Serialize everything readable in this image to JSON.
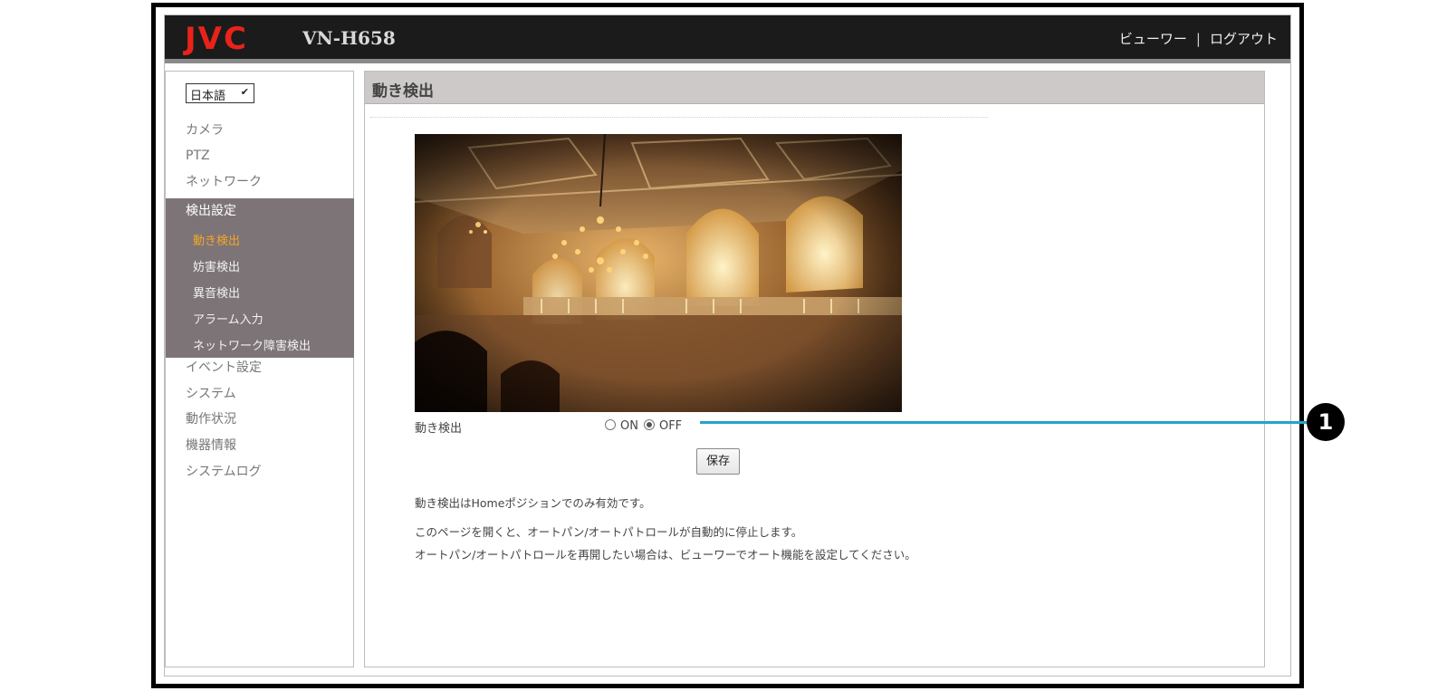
{
  "header": {
    "logo": "JVC",
    "model": "VN-H658",
    "links": {
      "viewer": "ビューワー",
      "separator": "|",
      "logout": "ログアウト"
    }
  },
  "sidebar": {
    "language": "日本語",
    "items_top": [
      "カメラ",
      "PTZ",
      "ネットワーク"
    ],
    "group": {
      "title": "検出設定",
      "items": [
        "動き検出",
        "妨害検出",
        "異音検出",
        "アラーム入力",
        "ネットワーク障害検出"
      ],
      "active_index": 0
    },
    "items_bottom": [
      "イベント設定",
      "システム",
      "動作状況",
      "機器情報",
      "システムログ"
    ]
  },
  "main": {
    "title": "動き検出",
    "setting": {
      "label": "動き検出",
      "options": [
        "ON",
        "OFF"
      ],
      "selected": "OFF"
    },
    "save_label": "保存",
    "notes": [
      "動き検出はHomeポジションでのみ有効です。",
      "このページを開くと、オートパン/オートパトロールが自動的に停止します。",
      "オートパン/オートパトロールを再開したい場合は、ビューワーでオート機能を設定してください。"
    ]
  },
  "callout": {
    "number": "1"
  },
  "colors": {
    "accent": "#f5a623",
    "callout_line": "#1fa5cc",
    "logo": "#e8231a"
  }
}
